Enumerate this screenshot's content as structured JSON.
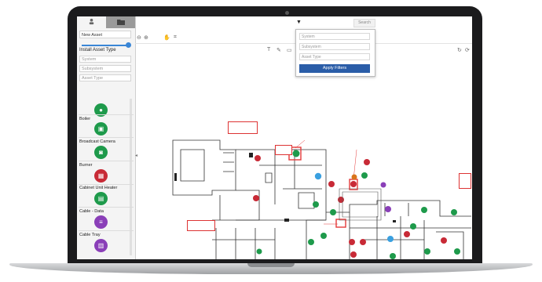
{
  "left_panel": {
    "tab_assets_icon": "person-pin-icon",
    "tab_layers_icon": "folder-icon",
    "asset_select": "New Asset",
    "install_heading": "Install Asset Type",
    "fields": {
      "system": "System",
      "subsystem": "Subsystem",
      "asset_type": "Asset Type"
    },
    "assets": [
      {
        "label": "Boiler",
        "color": "#1e9a4b",
        "icon": "boiler-icon"
      },
      {
        "label": "Broadcast Camera",
        "color": "#1e9a4b",
        "icon": "camera-icon"
      },
      {
        "label": "Burner",
        "color": "#c82a36",
        "icon": "burner-icon"
      },
      {
        "label": "Cabinet Unit Heater",
        "color": "#1e9a4b",
        "icon": "heater-icon"
      },
      {
        "label": "Cable - Data",
        "color": "#8a3fb8",
        "icon": "cable-icon"
      },
      {
        "label": "Cable Tray",
        "color": "#8a3fb8",
        "icon": "tray-icon"
      }
    ]
  },
  "filter": {
    "search_label": "Search",
    "system": "System",
    "subsystem": "Subsystem",
    "asset_type": "Asset Type",
    "apply_label": "Apply Filters"
  },
  "colors": {
    "accent": "#2a5da8",
    "green": "#1e9a4b",
    "red": "#c82a36",
    "purple": "#8a3fb8",
    "blue": "#3aa0e0",
    "orange": "#d9731a"
  }
}
